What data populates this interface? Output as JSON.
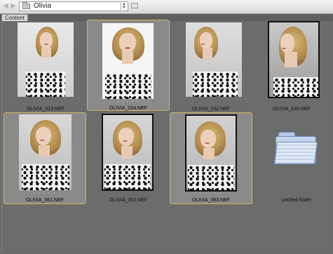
{
  "toolbar": {
    "back_icon": "arrow-left-icon",
    "forward_icon": "arrow-right-icon",
    "path_label": "Olivia",
    "stepper_icon": "stepper-icon"
  },
  "panel": {
    "tab_label": "Content"
  },
  "items": [
    {
      "filename": "OLIVIA_013.NEF",
      "selected": false,
      "dots": ""
    },
    {
      "filename": "OLIVIA_024.NEF",
      "selected": true,
      "dots": "• • • • •"
    },
    {
      "filename": "OLIVIA_032.NEF",
      "selected": false,
      "dots": ""
    },
    {
      "filename": "OLIVIA_035.NEF",
      "selected": false,
      "dots": ""
    },
    {
      "filename": "OLIVIA_061.NEF",
      "selected": true,
      "dots": "• • • • •"
    },
    {
      "filename": "OLIVIA_062.NEF",
      "selected": false,
      "dots": ""
    },
    {
      "filename": "OLIVIA_063.NEF",
      "selected": true,
      "dots": "• • • • •"
    },
    {
      "filename": "untitled folder",
      "selected": false,
      "dots": ""
    }
  ],
  "colors": {
    "background": "#6b6b6b",
    "selection_border": "#c9b660",
    "selection_fill": "#8a8a8a"
  }
}
